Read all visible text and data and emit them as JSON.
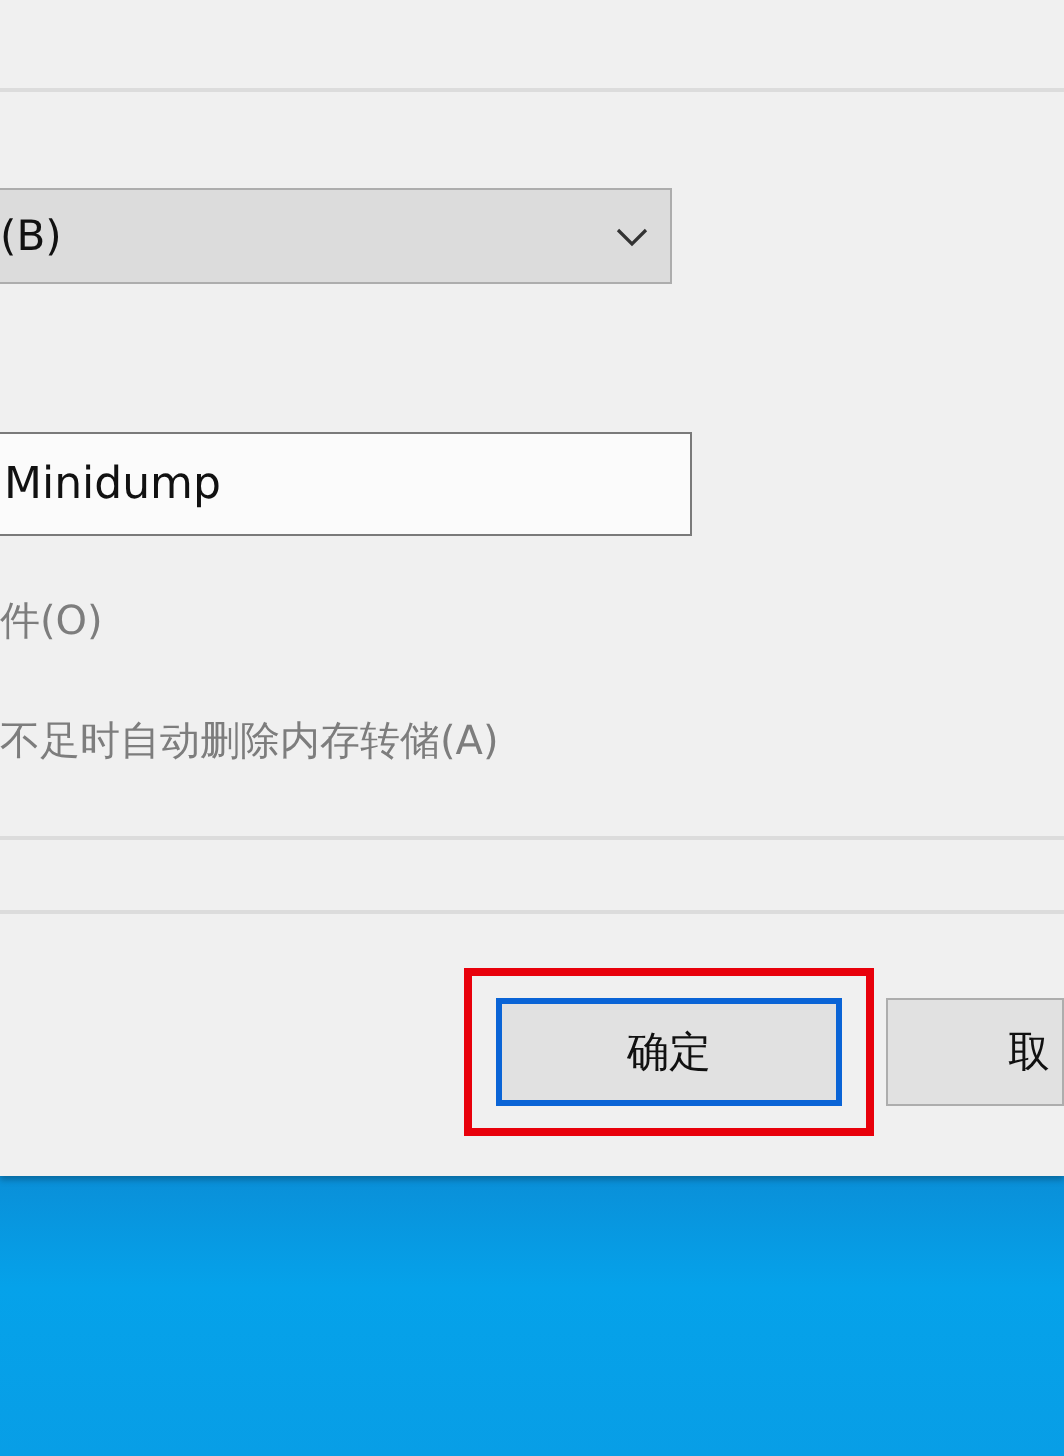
{
  "dropdown": {
    "value": "(B)"
  },
  "filename_field": {
    "value": "Minidump"
  },
  "options": [
    {
      "label": "件(O)",
      "disabled": true
    },
    {
      "label": "不足时自动删除内存转储(A)",
      "disabled": true
    }
  ],
  "buttons": [
    {
      "label": "确定",
      "focused": true,
      "highlighted": true
    },
    {
      "label": "取",
      "focused": false,
      "highlighted": false
    }
  ]
}
